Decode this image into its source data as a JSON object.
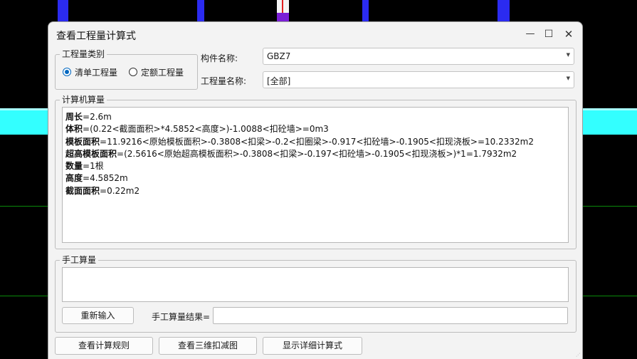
{
  "dialog": {
    "title": "查看工程量计算式",
    "window_controls": {
      "minimize": "—",
      "maximize": "☐",
      "close": "✕"
    }
  },
  "quantity_type": {
    "label": "工程量类别",
    "options": [
      {
        "label": "清单工程量",
        "checked": true
      },
      {
        "label": "定额工程量",
        "checked": false
      }
    ]
  },
  "component": {
    "label": "构件名称:",
    "value": "GBZ7"
  },
  "quantity_name": {
    "label": "工程量名称:",
    "value": "[全部]"
  },
  "computer_calc": {
    "label": "计算机算量",
    "lines": [
      {
        "key": "周长",
        "expr": "=2.6m"
      },
      {
        "key": "体积",
        "expr": "=(0.22<截面面积>*4.5852<高度>)-1.0088<扣砼墙>=0m3"
      },
      {
        "key": "模板面积",
        "expr": "=11.9216<原始模板面积>-0.3808<扣梁>-0.2<扣圈梁>-0.917<扣砼墙>-0.1905<扣现浇板>=10.2332m2"
      },
      {
        "key": "超高模板面积",
        "expr": "=(2.5616<原始超高模板面积>-0.3808<扣梁>-0.197<扣砼墙>-0.1905<扣现浇板>)*1=1.7932m2"
      },
      {
        "key": "数量",
        "expr": "=1根"
      },
      {
        "key": "高度",
        "expr": "=4.5852m"
      },
      {
        "key": "截面面积",
        "expr": "=0.22m2"
      }
    ]
  },
  "manual_calc": {
    "label": "手工算量",
    "reinput_label": "重新输入",
    "result_label": "手工算量结果=",
    "result_value": ""
  },
  "bottom_buttons": {
    "view_rules": "查看计算规则",
    "view_3d": "查看三维扣减图",
    "show_detail": "显示详细计算式"
  },
  "colors": {
    "cad_background": "#000000",
    "cad_column": "#2b2bf0",
    "cad_wall": "#33ffff",
    "cad_axis": "#0a8a0a",
    "accent": "#0067c0"
  }
}
